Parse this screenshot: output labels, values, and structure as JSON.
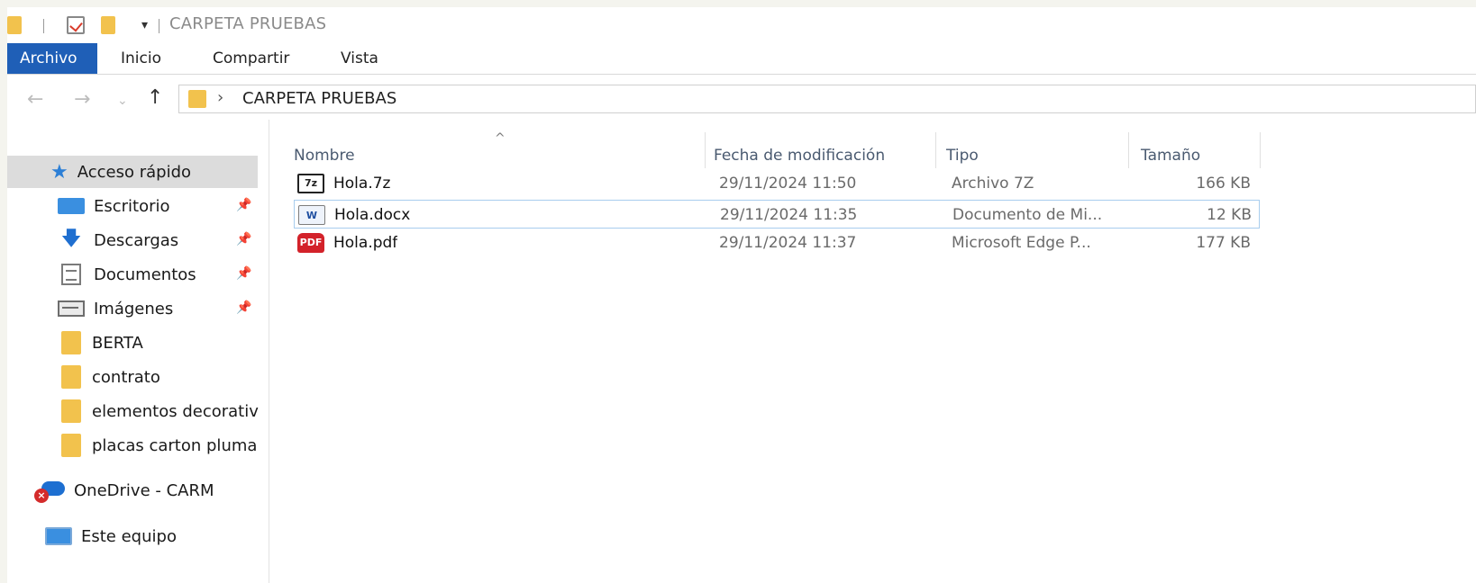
{
  "window": {
    "title": "CARPETA PRUEBAS"
  },
  "ribbon": {
    "tabs": [
      "Archivo",
      "Inicio",
      "Compartir",
      "Vista"
    ]
  },
  "address": {
    "path_segment": "CARPETA PRUEBAS"
  },
  "sidebar": {
    "quick_access": "Acceso rápido",
    "items": [
      {
        "label": "Escritorio",
        "icon": "desktop-icon",
        "pinned": true
      },
      {
        "label": "Descargas",
        "icon": "download-icon",
        "pinned": true
      },
      {
        "label": "Documentos",
        "icon": "documents-icon",
        "pinned": true
      },
      {
        "label": "Imágenes",
        "icon": "pictures-icon",
        "pinned": true
      },
      {
        "label": "BERTA",
        "icon": "folder-icon",
        "pinned": false
      },
      {
        "label": "contrato",
        "icon": "folder-icon",
        "pinned": false
      },
      {
        "label": "elementos decorativ",
        "icon": "folder-icon",
        "pinned": false
      },
      {
        "label": "placas carton pluma",
        "icon": "folder-icon",
        "pinned": false
      }
    ],
    "onedrive": "OneDrive - CARM",
    "this_pc": "Este equipo"
  },
  "columns": {
    "name": "Nombre",
    "modified": "Fecha de modificación",
    "type": "Tipo",
    "size": "Tamaño"
  },
  "files": [
    {
      "name": "Hola.7z",
      "modified": "29/11/2024 11:50",
      "type": "Archivo 7Z",
      "size": "166 KB",
      "icon": "7z-file-icon",
      "icon_text": "7z"
    },
    {
      "name": "Hola.docx",
      "modified": "29/11/2024 11:35",
      "type": "Documento de Mi...",
      "size": "12 KB",
      "icon": "word-file-icon",
      "icon_text": "W"
    },
    {
      "name": "Hola.pdf",
      "modified": "29/11/2024 11:37",
      "type": "Microsoft Edge P...",
      "size": "177 KB",
      "icon": "pdf-file-icon",
      "icon_text": "PDF"
    }
  ]
}
